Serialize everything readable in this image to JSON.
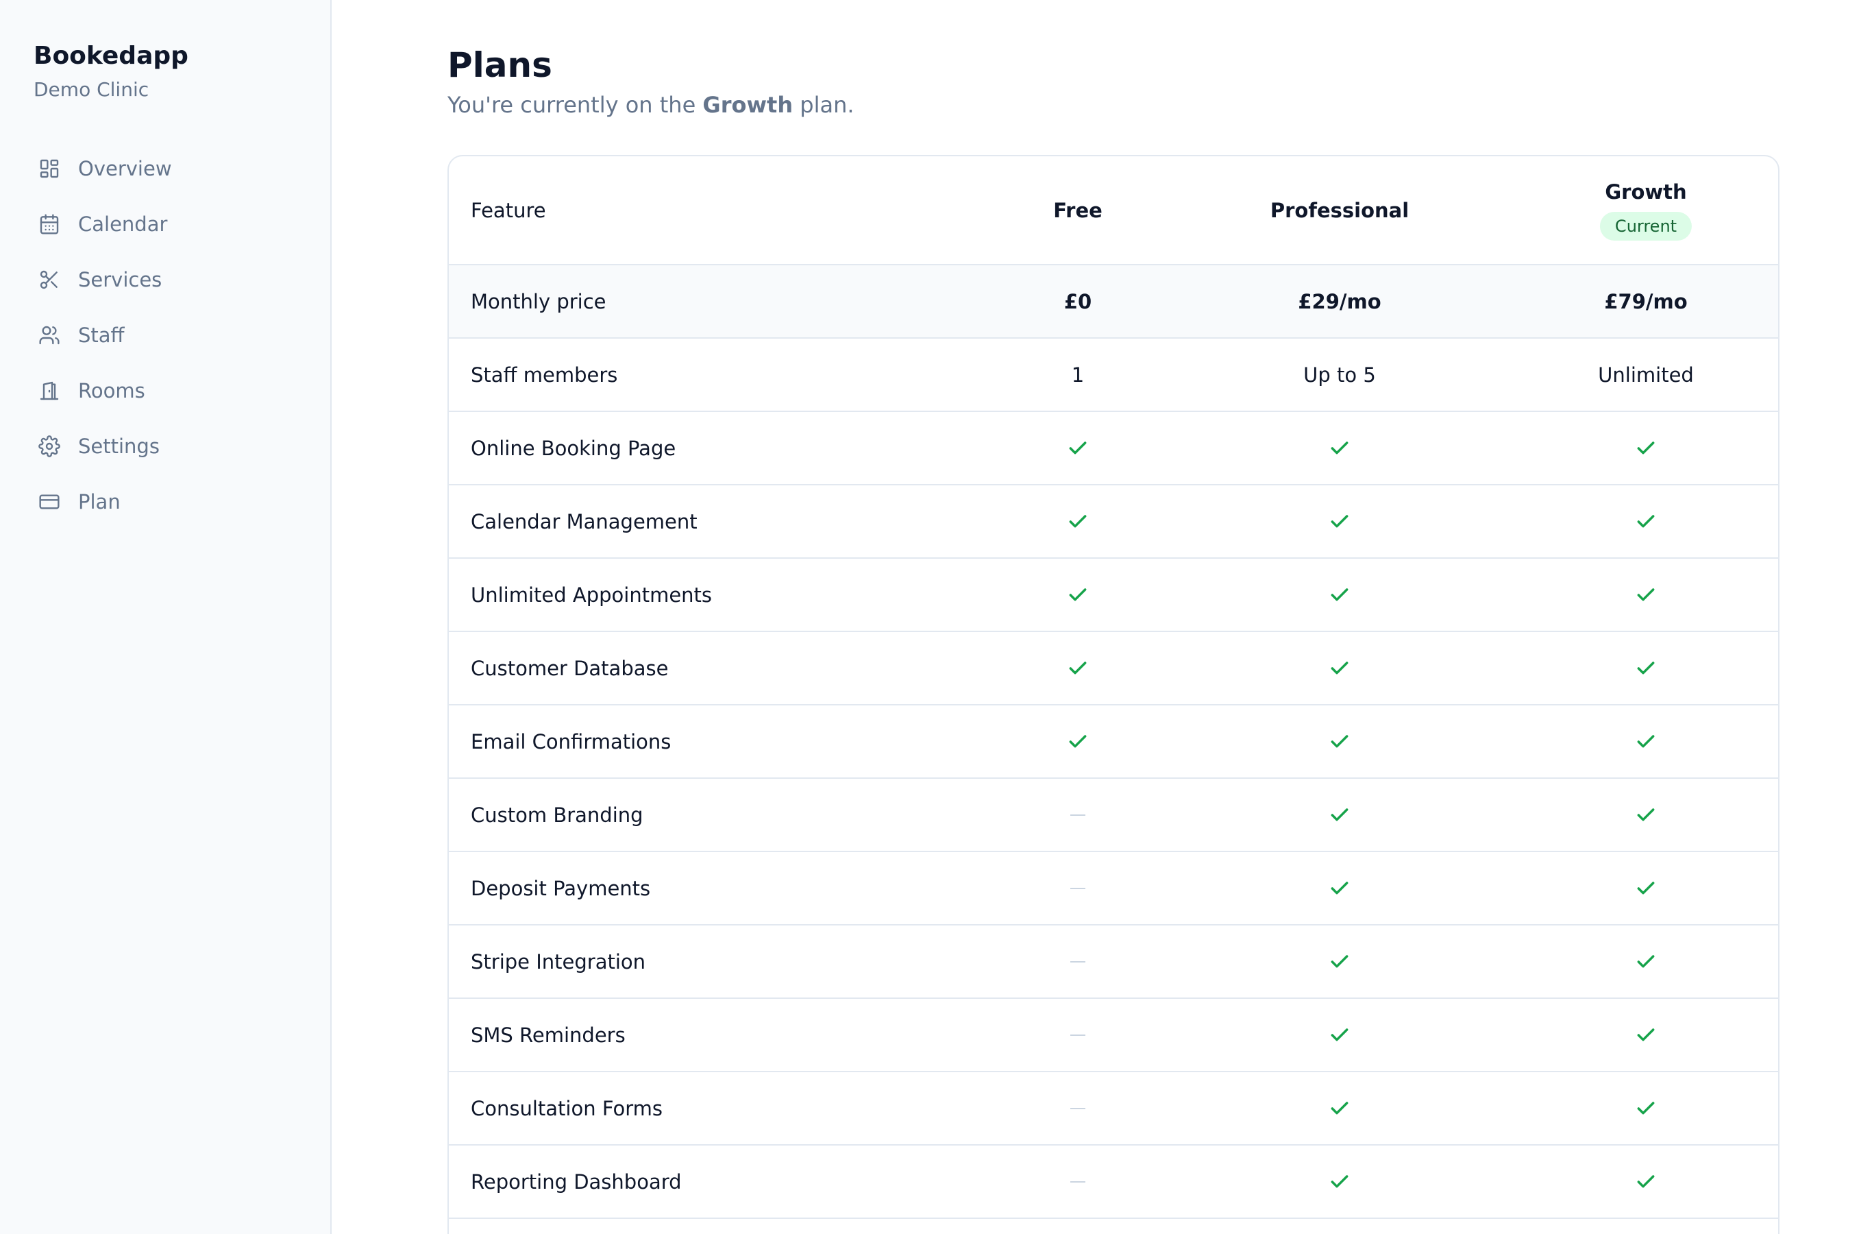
{
  "sidebar": {
    "brand": "Bookedapp",
    "clinic": "Demo Clinic",
    "items": [
      {
        "label": "Overview",
        "icon": "overview-icon"
      },
      {
        "label": "Calendar",
        "icon": "calendar-icon"
      },
      {
        "label": "Services",
        "icon": "scissors-icon"
      },
      {
        "label": "Staff",
        "icon": "users-icon"
      },
      {
        "label": "Rooms",
        "icon": "door-icon"
      },
      {
        "label": "Settings",
        "icon": "gear-icon"
      },
      {
        "label": "Plan",
        "icon": "credit-card-icon"
      }
    ]
  },
  "main": {
    "title": "Plans",
    "subtitle_prefix": "You're currently on the ",
    "subtitle_plan": "Growth",
    "subtitle_suffix": " plan."
  },
  "table": {
    "header": {
      "feature": "Feature",
      "free": "Free",
      "professional": "Professional",
      "growth": "Growth",
      "current_badge": "Current"
    },
    "price": {
      "label": "Monthly price",
      "free": "£0",
      "professional": "£29/mo",
      "growth": "£79/mo"
    },
    "staff": {
      "label": "Staff members",
      "free": "1",
      "professional": "Up to 5",
      "growth": "Unlimited"
    },
    "features": [
      {
        "label": "Online Booking Page",
        "free": true,
        "professional": true,
        "growth": true
      },
      {
        "label": "Calendar Management",
        "free": true,
        "professional": true,
        "growth": true
      },
      {
        "label": "Unlimited Appointments",
        "free": true,
        "professional": true,
        "growth": true
      },
      {
        "label": "Customer Database",
        "free": true,
        "professional": true,
        "growth": true
      },
      {
        "label": "Email Confirmations",
        "free": true,
        "professional": true,
        "growth": true
      },
      {
        "label": "Custom Branding",
        "free": false,
        "professional": true,
        "growth": true
      },
      {
        "label": "Deposit Payments",
        "free": false,
        "professional": true,
        "growth": true
      },
      {
        "label": "Stripe Integration",
        "free": false,
        "professional": true,
        "growth": true
      },
      {
        "label": "SMS Reminders",
        "free": false,
        "professional": true,
        "growth": true
      },
      {
        "label": "Consultation Forms",
        "free": false,
        "professional": true,
        "growth": true
      },
      {
        "label": "Reporting Dashboard",
        "free": false,
        "professional": true,
        "growth": true
      }
    ]
  },
  "colors": {
    "check": "#16a34a",
    "badge_bg": "#dcfce7",
    "badge_text": "#166534",
    "muted": "#64748b"
  }
}
